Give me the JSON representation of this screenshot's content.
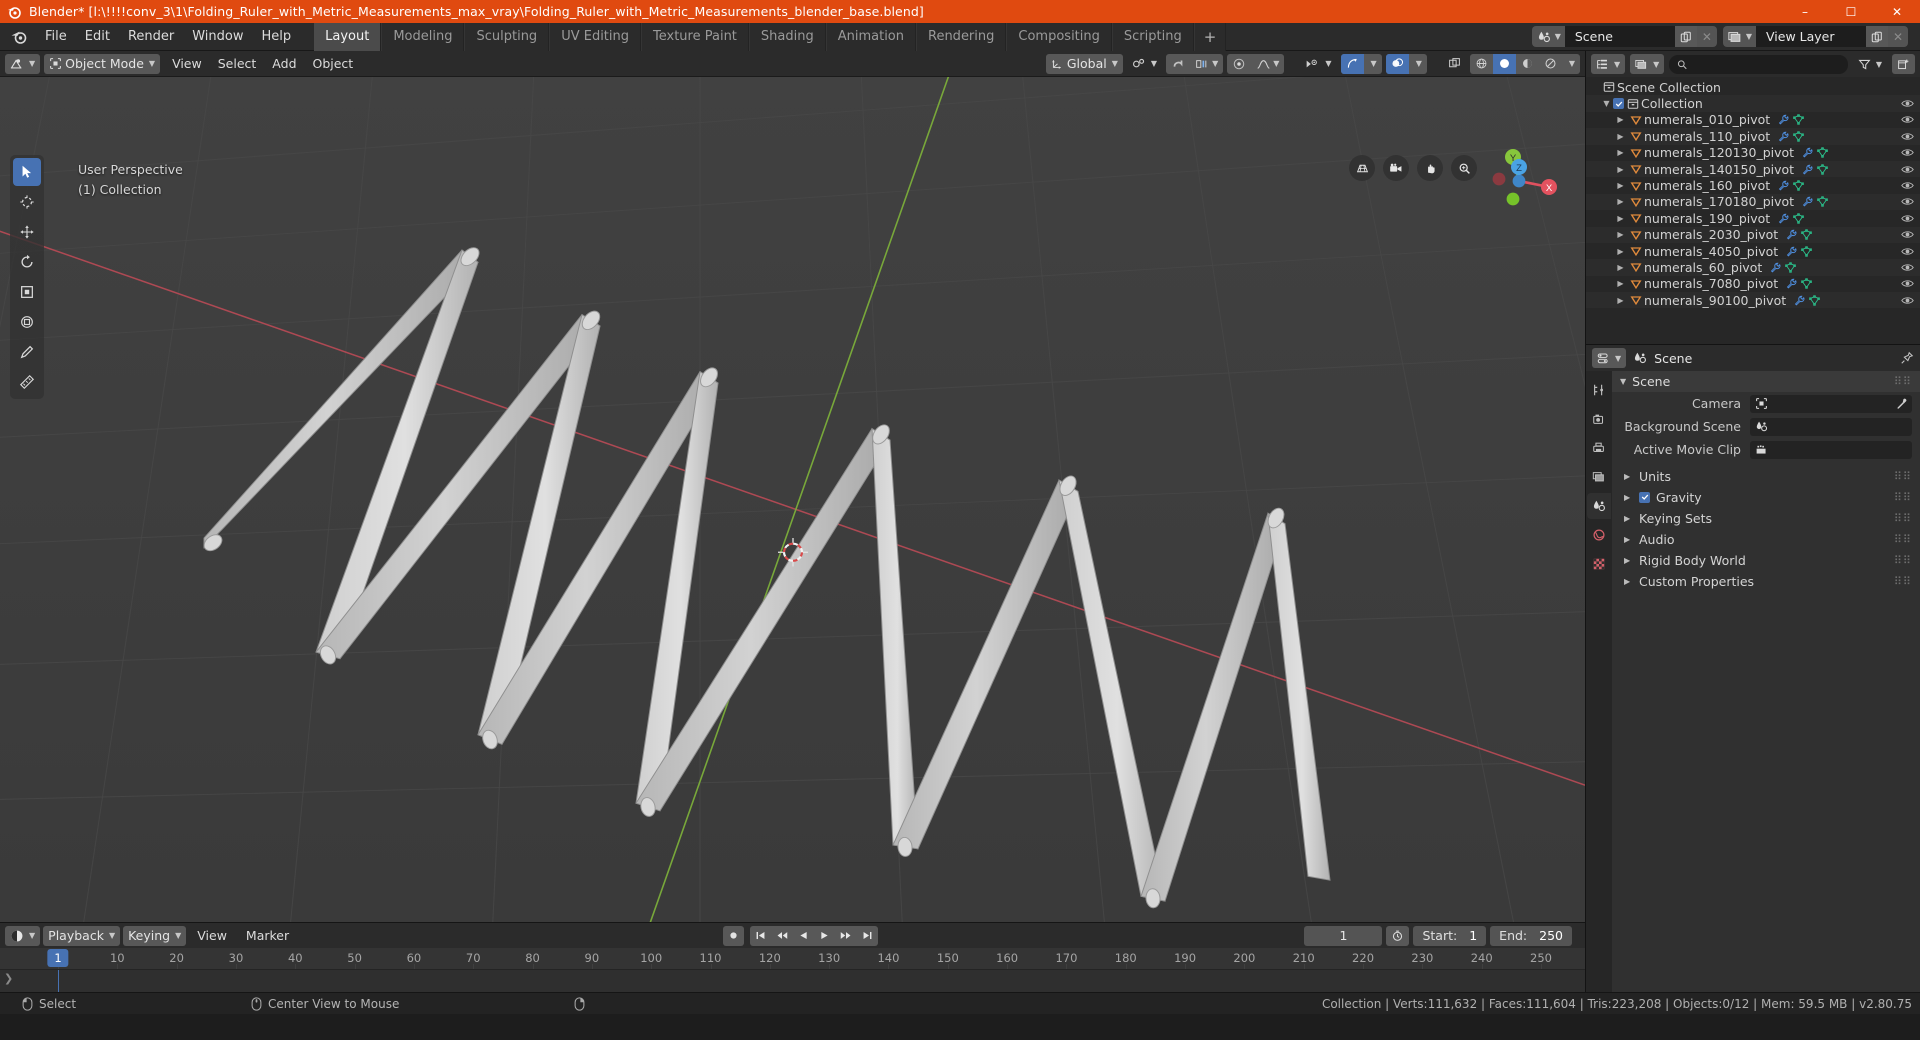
{
  "titlebar": {
    "app_title": "Blender* [l:\\!!!!conv_3\\1\\Folding_Ruler_with_Metric_Measurements_max_vray\\Folding_Ruler_with_Metric_Measurements_blender_base.blend]",
    "minimize": "–",
    "maximize": "☐",
    "close": "✕"
  },
  "topbar": {
    "menus": [
      "File",
      "Edit",
      "Render",
      "Window",
      "Help"
    ],
    "workspaces": [
      {
        "label": "Layout",
        "active": true
      },
      {
        "label": "Modeling",
        "active": false
      },
      {
        "label": "Sculpting",
        "active": false
      },
      {
        "label": "UV Editing",
        "active": false
      },
      {
        "label": "Texture Paint",
        "active": false
      },
      {
        "label": "Shading",
        "active": false
      },
      {
        "label": "Animation",
        "active": false
      },
      {
        "label": "Rendering",
        "active": false
      },
      {
        "label": "Compositing",
        "active": false
      },
      {
        "label": "Scripting",
        "active": false
      }
    ],
    "add_workspace": "+",
    "scene_name": "Scene",
    "view_layer_name": "View Layer"
  },
  "viewport_header": {
    "editor_type": "editor-type-3d-viewport",
    "mode": "Object Mode",
    "menus": [
      "View",
      "Select",
      "Add",
      "Object"
    ],
    "transform_orientation": "Global",
    "snap_label": "snapping",
    "proportional_label": "proportional-editing"
  },
  "viewport": {
    "perspective": "User Perspective",
    "collection_info": "(1) Collection",
    "gizmo_axes": [
      "X",
      "Y",
      "Z"
    ],
    "tools": [
      "tweak-select-tool",
      "cursor-tool",
      "move-tool",
      "rotate-tool",
      "scale-tool",
      "transform-tool",
      "annotate-tool",
      "measure-tool"
    ],
    "nav_buttons": [
      "grid-toggle-icon",
      "camera-view-icon",
      "pan-view-icon",
      "zoom-view-icon"
    ],
    "background_color": "#3d3d3d",
    "object_color": "#c9c9c9",
    "x_axis_color": "#cf4553",
    "y_axis_color": "#7dbc2b"
  },
  "outliner": {
    "display_mode": "view-layer",
    "filter_icon": "filter-icon",
    "new_collection_icon": "new-collection-icon",
    "search_placeholder": "",
    "root": "Scene Collection",
    "collection": "Collection",
    "items": [
      {
        "label": "numerals_010_pivot"
      },
      {
        "label": "numerals_110_pivot"
      },
      {
        "label": "numerals_120130_pivot"
      },
      {
        "label": "numerals_140150_pivot"
      },
      {
        "label": "numerals_160_pivot"
      },
      {
        "label": "numerals_170180_pivot"
      },
      {
        "label": "numerals_190_pivot"
      },
      {
        "label": "numerals_2030_pivot"
      },
      {
        "label": "numerals_4050_pivot"
      },
      {
        "label": "numerals_60_pivot"
      },
      {
        "label": "numerals_7080_pivot"
      },
      {
        "label": "numerals_90100_pivot"
      }
    ]
  },
  "properties": {
    "breadcrumb": "Scene",
    "pin_icon": "pin-icon",
    "tabs": [
      "tool-tab",
      "render-tab",
      "output-tab",
      "view-layer-tab",
      "scene-tab",
      "world-tab",
      "texture-tab"
    ],
    "active_tab_index": 4,
    "panel_title": "Scene",
    "fields": [
      {
        "label": "Camera",
        "value": "",
        "icon": "camera-icon",
        "eyedropper": true
      },
      {
        "label": "Background Scene",
        "value": "",
        "icon": "scene-icon",
        "eyedropper": false
      },
      {
        "label": "Active Movie Clip",
        "value": "",
        "icon": "clip-icon",
        "eyedropper": false
      }
    ],
    "collapsed_panels": [
      {
        "label": "Units",
        "checkbox": false
      },
      {
        "label": "Gravity",
        "checkbox": true
      },
      {
        "label": "Keying Sets",
        "checkbox": false
      },
      {
        "label": "Audio",
        "checkbox": false
      },
      {
        "label": "Rigid Body World",
        "checkbox": false
      },
      {
        "label": "Custom Properties",
        "checkbox": false
      }
    ]
  },
  "timeline": {
    "editor_type": "timeline-editor",
    "menus": [
      "Playback",
      "Keying",
      "View",
      "Marker"
    ],
    "record_icon": "record-icon",
    "transport": [
      "jump-start-icon",
      "prev-keyframe-icon",
      "play-reverse-icon",
      "play-icon",
      "next-keyframe-icon",
      "jump-end-icon"
    ],
    "current_frame": "1",
    "auto_key_icon": "auto-keying-icon",
    "start_label": "Start:",
    "start_value": "1",
    "end_label": "End:",
    "end_value": "250",
    "ruler_ticks": [
      "1",
      "10",
      "20",
      "30",
      "40",
      "50",
      "60",
      "70",
      "80",
      "90",
      "100",
      "110",
      "120",
      "130",
      "140",
      "150",
      "160",
      "170",
      "180",
      "190",
      "200",
      "210",
      "220",
      "230",
      "240",
      "250"
    ],
    "playhead_frame": "1"
  },
  "statusbar": {
    "mouse_left_label": "Select",
    "mouse_middle_label": "Center View to Mouse",
    "stats": "Collection | Verts:111,632 | Faces:111,604 | Tris:223,208 | Objects:0/12 | Mem: 59.5 MB | v2.80.75"
  }
}
